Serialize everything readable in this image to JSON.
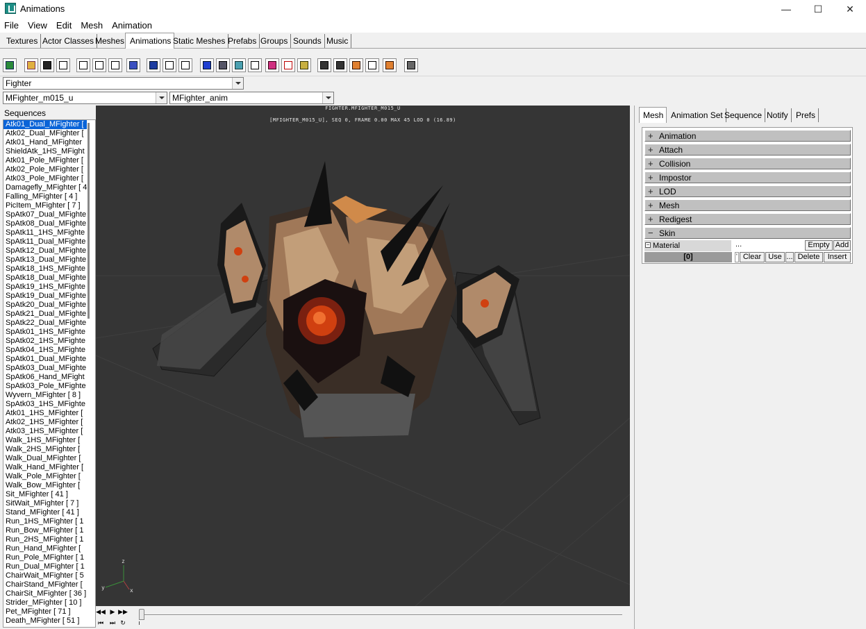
{
  "window": {
    "title": "Animations",
    "controls": [
      "minimize-icon",
      "maximize-icon",
      "close-icon"
    ]
  },
  "menu": [
    "File",
    "View",
    "Edit",
    "Mesh",
    "Animation"
  ],
  "tabs": [
    "Textures",
    "Actor Classes",
    "Meshes",
    "Animations",
    "Static Meshes",
    "Prefabs",
    "Groups",
    "Sounds",
    "Music"
  ],
  "active_tab": "Animations",
  "combos": {
    "package": "Fighter",
    "mesh": "MFighter_m015_u",
    "anim": "MFighter_anim"
  },
  "sequences": {
    "label": "Sequences",
    "items": [
      "Atk01_Dual_MFighter [",
      "Atk02_Dual_MFighter [",
      "Atk01_Hand_MFighter",
      "ShieldAtk_1HS_MFight",
      "Atk01_Pole_MFighter [",
      "Atk02_Pole_MFighter [",
      "Atk03_Pole_MFighter [",
      "Damagefly_MFighter [ 4",
      "Falling_MFighter [ 4 ]",
      "PicItem_MFighter [ 7 ]",
      "SpAtk07_Dual_MFighte",
      "SpAtk08_Dual_MFighte",
      "SpAtk11_1HS_MFighte",
      "SpAtk11_Dual_MFighte",
      "SpAtk12_Dual_MFighte",
      "SpAtk13_Dual_MFighte",
      "SpAtk18_1HS_MFighte",
      "SpAtk18_Dual_MFighte",
      "SpAtk19_1HS_MFighte",
      "SpAtk19_Dual_MFighte",
      "SpAtk20_Dual_MFighte",
      "SpAtk21_Dual_MFighte",
      "SpAtk22_Dual_MFighte",
      "SpAtk01_1HS_MFighte",
      "SpAtk02_1HS_MFighte",
      "SpAtk04_1HS_MFighte",
      "SpAtk01_Dual_MFighte",
      "SpAtk03_Dual_MFighte",
      "SpAtk06_Hand_MFight",
      "SpAtk03_Pole_MFighte",
      "Wyvern_MFighter [ 8 ]",
      "SpAtk03_1HS_MFighte",
      "Atk01_1HS_MFighter [",
      "Atk02_1HS_MFighter [",
      "Atk03_1HS_MFighter [",
      "Walk_1HS_MFighter [",
      "Walk_2HS_MFighter [",
      "Walk_Dual_MFighter [",
      "Walk_Hand_MFighter [",
      "Walk_Pole_MFighter [",
      "Walk_Bow_MFighter [",
      "Sit_MFighter [ 41 ]",
      "SitWait_MFighter [ 7 ]",
      "Stand_MFighter [ 41 ]",
      "Run_1HS_MFighter [ 1",
      "Run_Bow_MFighter [ 1",
      "Run_2HS_MFighter [ 1",
      "Run_Hand_MFighter [",
      "Run_Pole_MFighter [ 1",
      "Run_Dual_MFighter [ 1",
      "ChairWait_MFighter [ 5",
      "ChairStand_MFighter [",
      "ChairSit_MFighter [ 36 ]",
      "Strider_MFighter [ 10 ]",
      "Pet_MFighter [ 71 ]",
      "Death_MFighter [ 51 ]"
    ],
    "selected_index": 0
  },
  "viewport": {
    "title": "FIGHTER.MFIGHTER_M015_U",
    "info": "[MFIGHTER_M015_U], SEQ 0,  FRAME  0.00 MAX 45  LOD 0 (16.89)",
    "axes": {
      "z": "z",
      "y": "y",
      "x": "x"
    }
  },
  "right_panel": {
    "tabs": [
      "Mesh",
      "Animation Set",
      "Sequence",
      "Notify",
      "Prefs"
    ],
    "active_tab": "Mesh",
    "groups": [
      {
        "label": "Animation",
        "sign": "+"
      },
      {
        "label": "Attach",
        "sign": "+"
      },
      {
        "label": "Collision",
        "sign": "+"
      },
      {
        "label": "Impostor",
        "sign": "+"
      },
      {
        "label": "LOD",
        "sign": "+"
      },
      {
        "label": "Mesh",
        "sign": "+"
      },
      {
        "label": "Redigest",
        "sign": "+"
      },
      {
        "label": "Skin",
        "sign": "−"
      }
    ],
    "material": {
      "label": "Material",
      "dots": "...",
      "empty_btn": "Empty",
      "add_btn": "Add",
      "index": "[0]",
      "value_mark": "'",
      "clear_btn": "Clear",
      "use_btn": "Use",
      "more_btn": "...",
      "delete_btn": "Delete",
      "insert_btn": "Insert"
    }
  }
}
